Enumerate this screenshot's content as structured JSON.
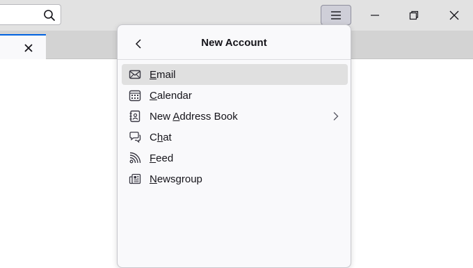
{
  "toolbar": {
    "search_icon": "search-icon",
    "menu_icon": "hamburger-menu-icon"
  },
  "window_controls": {
    "minimize_icon": "minimize-icon",
    "restore_icon": "restore-icon",
    "close_icon": "close-icon"
  },
  "tab": {
    "close_icon": "close-icon",
    "accent_color": "#0061e0"
  },
  "panel": {
    "back_icon": "chevron-left-icon",
    "title": "New Account",
    "items": [
      {
        "pre": "",
        "key": "E",
        "post": "mail",
        "icon": "envelope-icon",
        "submenu": false,
        "highlighted": true
      },
      {
        "pre": "",
        "key": "C",
        "post": "alendar",
        "icon": "calendar-icon",
        "submenu": false,
        "highlighted": false
      },
      {
        "pre": "New ",
        "key": "A",
        "post": "ddress Book",
        "icon": "address-book-icon",
        "submenu": true,
        "highlighted": false
      },
      {
        "pre": "C",
        "key": "h",
        "post": "at",
        "icon": "chat-icon",
        "submenu": false,
        "highlighted": false
      },
      {
        "pre": "",
        "key": "F",
        "post": "eed",
        "icon": "rss-feed-icon",
        "submenu": false,
        "highlighted": false
      },
      {
        "pre": "",
        "key": "N",
        "post": "ewsgroup",
        "icon": "newspaper-icon",
        "submenu": false,
        "highlighted": false
      }
    ]
  }
}
